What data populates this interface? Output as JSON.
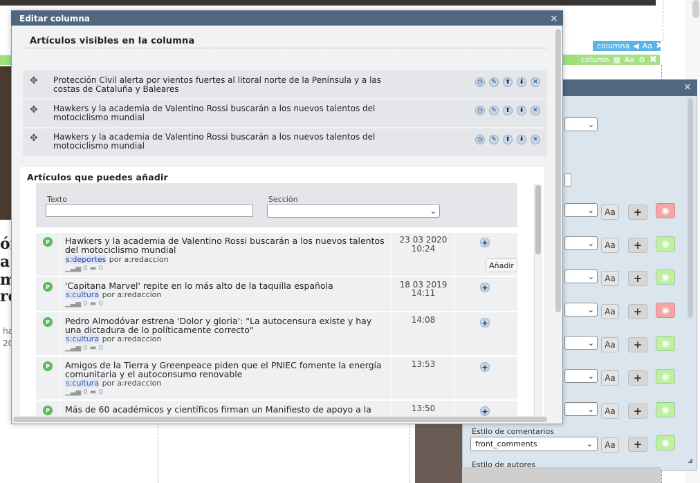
{
  "modal": {
    "title": "Editar columna",
    "close": "×",
    "visible_section_title": "Artículos visibles en la columna",
    "visible_articles": [
      {
        "title": "Protección Civil alerta por vientos fuertes al litoral norte de la Península y a las costas de Cataluña y Baleares"
      },
      {
        "title": "Hawkers y la academia de Valentino Rossi buscarán a los nuevos talentos del motociclismo mundial"
      },
      {
        "title": "Hawkers y la academia de Valentino Rossi buscarán a los nuevos talentos del motociclismo mundial"
      }
    ],
    "add_section_title": "Artículos que puedes añadir",
    "filters": {
      "text_label": "Texto",
      "section_label": "Sección",
      "text_value": "",
      "section_value": ""
    },
    "add_articles": [
      {
        "badge": "P",
        "title": "Hawkers y la academia de Valentino Rossi buscarán a los nuevos talentos del motociclismo mundial",
        "section": "s:deportes",
        "by": "por",
        "author": "a:redaccion",
        "views": "0",
        "comments": "0",
        "date": "23 03 2020",
        "time": "10:24"
      },
      {
        "badge": "P",
        "title": "'Capitana Marvel' repite en lo más alto de la taquilla española",
        "section": "s:cultura",
        "by": "por",
        "author": "a:redaccion",
        "views": "0",
        "comments": "0",
        "date": "18 03 2019",
        "time": "14:11"
      },
      {
        "badge": "P",
        "title": "Pedro Almodóvar estrena 'Dolor y gloria': \"La autocensura existe y hay una dictadura de lo políticamente correcto\"",
        "section": "s:cultura",
        "by": "por",
        "author": "a:redaccion",
        "views": "0",
        "comments": "0",
        "date": "",
        "time": "14:08"
      },
      {
        "badge": "P",
        "title": "Amigos de la Tierra y Greenpeace piden que el PNIEC fomente la energía comunitaria y el autoconsumo renovable",
        "section": "s:cultura",
        "by": "por",
        "author": "a:redaccion",
        "views": "0",
        "comments": "0",
        "date": "",
        "time": "13:53"
      },
      {
        "badge": "P",
        "title": "Más de 60 académicos y científicos firman un Manifiesto de apoyo a la",
        "section": "",
        "by": "",
        "author": "",
        "views": "",
        "comments": "",
        "date": "",
        "time": "13:50"
      }
    ],
    "tooltip": "Añadir"
  },
  "background": {
    "toolbar1": {
      "label": "columna",
      "aa": "Aa"
    },
    "toolbar2": {
      "label": "column",
      "aa": "Aa"
    },
    "left_chars": [
      "ór",
      "a",
      "m",
      "re"
    ],
    "left_small": [
      "ha",
      "20"
    ],
    "panel": {
      "comments_label": "Estilo de comentarios",
      "comments_select": "front_comments",
      "authors_label": "Estilo de autores",
      "aa": "Aa"
    }
  },
  "colors": {
    "header": "#50677e",
    "badge": "#5cb85c",
    "eye_red": "#f4a5a5",
    "eye_green": "#bff0a0"
  }
}
